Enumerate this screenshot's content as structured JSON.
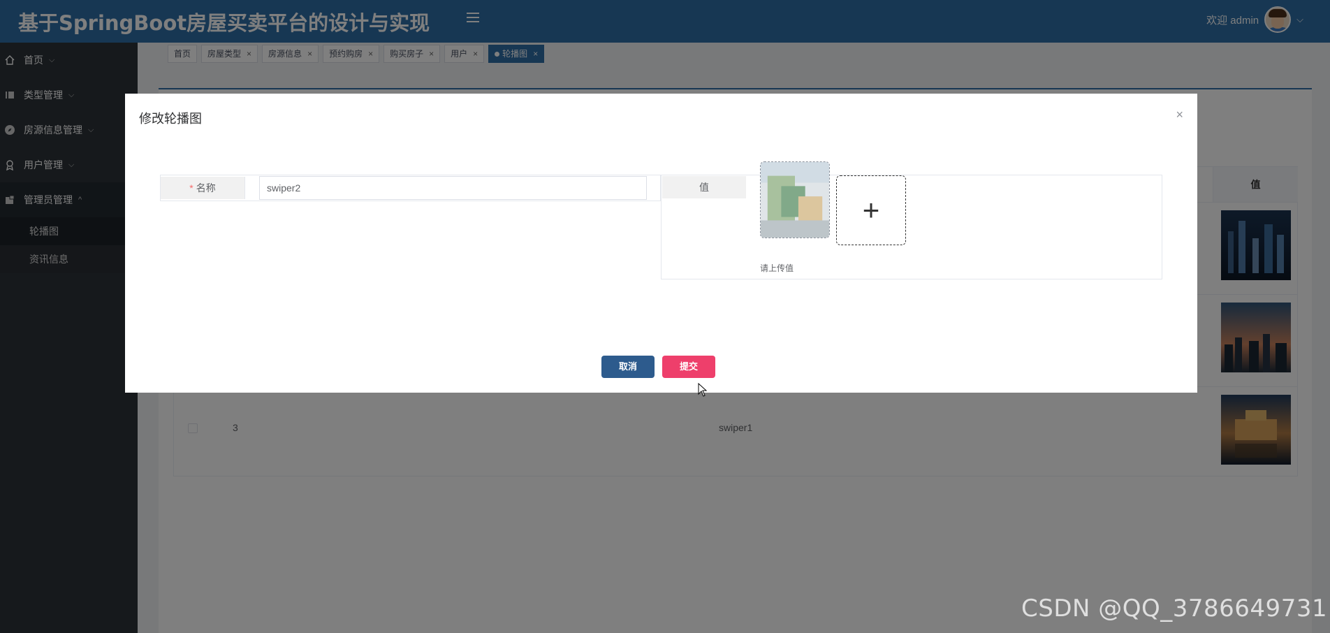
{
  "header": {
    "title": "基于SpringBoot房屋买卖平台的设计与实现",
    "welcome": "欢迎 admin",
    "menu_toggle_icon": "hamburger-icon",
    "chevron": "⌵"
  },
  "sidebar": {
    "items": [
      {
        "label": "首页",
        "icon": "home-icon",
        "arrow": "⌵"
      },
      {
        "label": "类型管理",
        "icon": "book-icon",
        "arrow": "⌵"
      },
      {
        "label": "房源信息管理",
        "icon": "compass-icon",
        "arrow": "⌵"
      },
      {
        "label": "用户管理",
        "icon": "user-badge-icon",
        "arrow": "⌵"
      },
      {
        "label": "管理员管理",
        "icon": "admin-icon",
        "arrow": "^"
      }
    ],
    "sub_items": [
      {
        "label": "轮播图"
      },
      {
        "label": "资讯信息"
      }
    ]
  },
  "tabs": [
    {
      "label": "首页",
      "closable": false
    },
    {
      "label": "房屋类型",
      "closable": true
    },
    {
      "label": "房源信息",
      "closable": true
    },
    {
      "label": "预约购房",
      "closable": true
    },
    {
      "label": "购买房子",
      "closable": true
    },
    {
      "label": "用户",
      "closable": true
    },
    {
      "label": "轮播图",
      "closable": true,
      "active": true
    }
  ],
  "tab_close_symbol": "×",
  "table": {
    "value_header": "值",
    "rows": [
      {
        "index": "",
        "name": ""
      },
      {
        "index": "",
        "name": ""
      },
      {
        "index": "3",
        "name": "swiper1"
      }
    ]
  },
  "dialog": {
    "title": "修改轮播图",
    "close_symbol": "×",
    "name_label": "名称",
    "required_mark": "*",
    "name_value": "swiper2",
    "value_label": "值",
    "upload_hint": "请上传值",
    "add_symbol": "+",
    "cancel_label": "取消",
    "submit_label": "提交"
  },
  "watermark": "CSDN @QQ_3786649731",
  "colors": {
    "header_bg": "#2f6fa7",
    "sidebar_bg": "#2d3238",
    "cancel_btn": "#2d5b8d",
    "submit_btn": "#ee3f6b"
  }
}
